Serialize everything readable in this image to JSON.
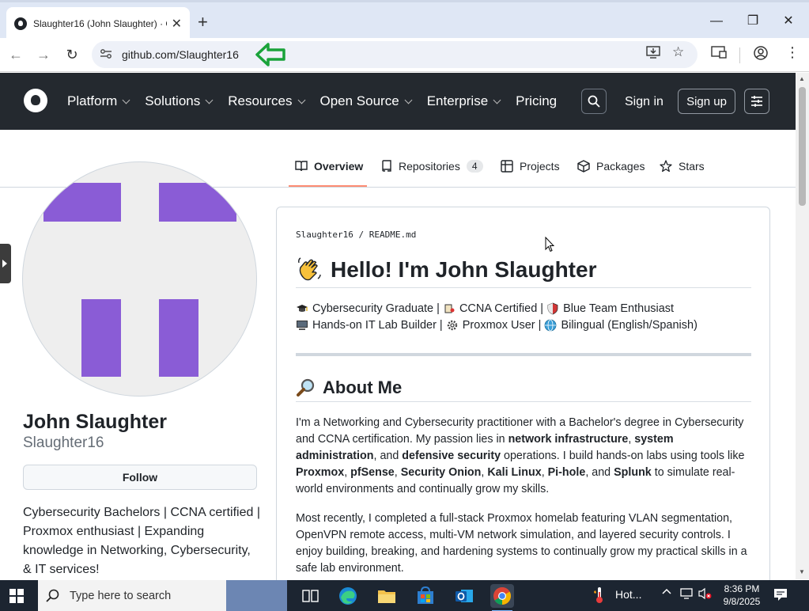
{
  "browser": {
    "tab_title": "Slaughter16 (John Slaughter) · G",
    "url": "github.com/Slaughter16"
  },
  "github_nav": {
    "items": [
      "Platform",
      "Solutions",
      "Resources",
      "Open Source",
      "Enterprise",
      "Pricing"
    ],
    "sign_in": "Sign in",
    "sign_up": "Sign up"
  },
  "profile_tabs": {
    "overview": "Overview",
    "repositories": "Repositories",
    "repositories_count": "4",
    "projects": "Projects",
    "packages": "Packages",
    "stars": "Stars"
  },
  "profile": {
    "name": "John Slaughter",
    "login": "Slaughter16",
    "follow": "Follow",
    "bio": "Cybersecurity Bachelors | CCNA certified | Proxmox enthusiast | Expanding knowledge in Networking, Cybersecurity, & IT services!",
    "avatar_color": "#8a5cd6"
  },
  "readme": {
    "path": "Slaughter16 / README.md",
    "heading": "Hello! I'm John Slaughter",
    "tagline1": {
      "a": "Cybersecurity Graduate |",
      "b": "CCNA Certified |",
      "c": "Blue Team Enthusiast"
    },
    "tagline2": {
      "a": "Hands-on IT Lab Builder |",
      "b": "Proxmox User |",
      "c": "Bilingual (English/Spanish)"
    },
    "about_heading": "About Me",
    "p1": {
      "t1": "I'm a Networking and Cybersecurity practitioner with a Bachelor's degree in Cybersecurity and CCNA certification. My passion lies in ",
      "b1": "network infrastructure",
      "t2": ", ",
      "b2": "system administration",
      "t3": ", and ",
      "b3": "defensive security",
      "t4": " operations. I build hands-on labs using tools like ",
      "b4": "Proxmox",
      "t5": ", ",
      "b5": "pfSense",
      "t6": ", ",
      "b6": "Security Onion",
      "t7": ", ",
      "b7": "Kali Linux",
      "t8": ", ",
      "b8": "Pi-hole",
      "t9": ", and ",
      "b9": "Splunk",
      "t10": " to simulate real-world environments and continually grow my skills."
    },
    "p2": "Most recently, I completed a full-stack Proxmox homelab featuring VLAN segmentation, OpenVPN remote access, multi-VM network simulation, and layered security controls. I enjoy building, breaking, and hardening systems to continually grow my practical skills in a safe lab environment."
  },
  "taskbar": {
    "search_placeholder": "Type here to search",
    "weather": "Hot...",
    "time": "8:36 PM",
    "date": "9/8/2025"
  }
}
